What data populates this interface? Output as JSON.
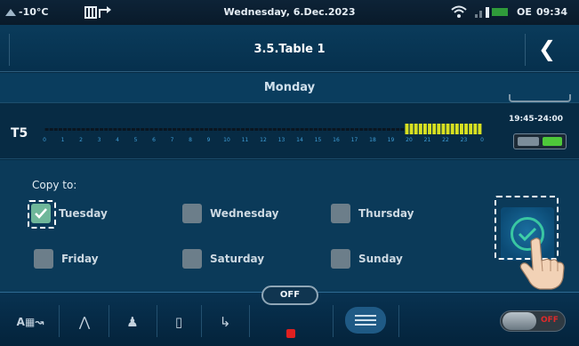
{
  "status_bar": {
    "outdoor_temp": "-10°C",
    "date": "Wednesday, 6.Dec.2023",
    "mode": "OE",
    "time": "09:34"
  },
  "title_bar": {
    "title": "3.5.Table 1",
    "back_icon": "chevron-left-icon"
  },
  "day_header": {
    "day": "Monday"
  },
  "schedule_row": {
    "label": "T5",
    "time_range": "19:45-24:00",
    "hours": [
      "0",
      "1",
      "2",
      "3",
      "4",
      "5",
      "6",
      "7",
      "8",
      "9",
      "10",
      "11",
      "12",
      "13",
      "14",
      "15",
      "16",
      "17",
      "18",
      "19",
      "20",
      "21",
      "22",
      "23",
      "0"
    ],
    "active_from_hour": 19.75,
    "active_to_hour": 24,
    "enabled": true
  },
  "copy_panel": {
    "label": "Copy to:",
    "days": [
      {
        "label": "Tuesday",
        "checked": true
      },
      {
        "label": "Wednesday",
        "checked": false
      },
      {
        "label": "Thursday",
        "checked": false
      },
      {
        "label": "Friday",
        "checked": false
      },
      {
        "label": "Saturday",
        "checked": false
      },
      {
        "label": "Sunday",
        "checked": false
      }
    ],
    "confirm_icon": "check-circle-icon"
  },
  "bottom_bar": {
    "state_label": "OFF",
    "power_label": "OFF"
  },
  "colors": {
    "background": "#062b44",
    "active_segment": "#d8e021",
    "enabled_toggle": "#4ec83a",
    "checked_box": "#6fb79a",
    "off_indicator": "#e02020"
  }
}
